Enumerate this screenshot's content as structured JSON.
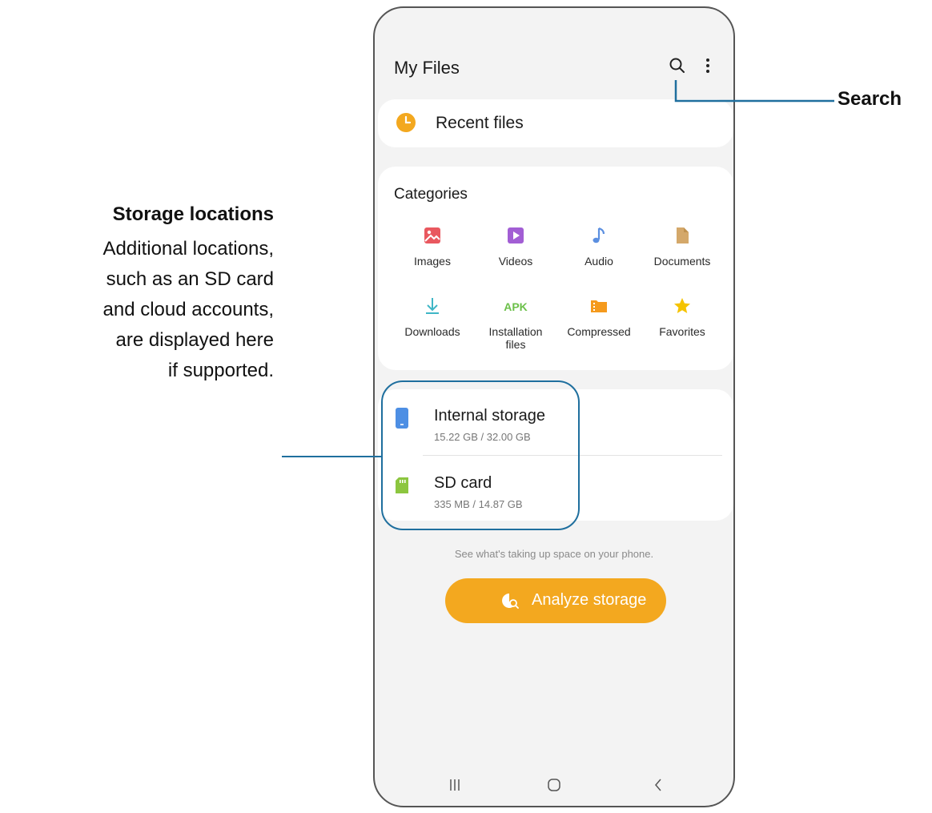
{
  "app": {
    "title": "My Files"
  },
  "recent": {
    "label": "Recent files"
  },
  "categories": {
    "title": "Categories",
    "items": [
      {
        "label": "Images",
        "icon": "image-icon",
        "color": "#e9585f"
      },
      {
        "label": "Videos",
        "icon": "video-icon",
        "color": "#a25ed4"
      },
      {
        "label": "Audio",
        "icon": "music-note-icon",
        "color": "#5b8fe0"
      },
      {
        "label": "Documents",
        "icon": "document-icon",
        "color": "#d4a86a"
      },
      {
        "label": "Downloads",
        "icon": "download-icon",
        "color": "#3fb6c6"
      },
      {
        "label": "Installation\nfiles",
        "icon": "apk-icon",
        "color": "#6cc04a",
        "icon_text": "APK"
      },
      {
        "label": "Compressed",
        "icon": "archive-icon",
        "color": "#f59a1d"
      },
      {
        "label": "Favorites",
        "icon": "star-icon",
        "color": "#f5c300"
      }
    ]
  },
  "storage": [
    {
      "name": "Internal storage",
      "size": "15.22 GB / 32.00 GB",
      "icon": "phone-icon",
      "color": "#4d8fe4"
    },
    {
      "name": "SD card",
      "size": "335 MB / 14.87 GB",
      "icon": "sd-card-icon",
      "color": "#8cc63f"
    }
  ],
  "hint": "See what's taking up space on your phone.",
  "analyze": {
    "label": "Analyze storage"
  },
  "annotations": {
    "search": "Search",
    "storage_title": "Storage locations",
    "storage_desc_lines": [
      "Additional locations,",
      "such as an SD card",
      "and cloud accounts,",
      "are displayed here",
      "if supported."
    ]
  },
  "colors": {
    "accent": "#f3a81f",
    "callout": "#1f6f9e",
    "screen_bg": "#f3f3f3"
  }
}
